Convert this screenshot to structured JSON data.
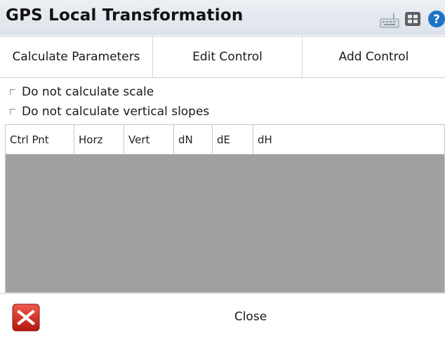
{
  "window": {
    "title": "GPS Local Transformation"
  },
  "titlebar_icons": [
    "keyboard-icon",
    "windows-icon",
    "help-icon"
  ],
  "toolbar": {
    "calculate_label": "Calculate Parameters",
    "edit_label": "Edit Control",
    "add_label": "Add Control"
  },
  "options": [
    {
      "label": "Do not calculate scale",
      "checked": false
    },
    {
      "label": "Do not calculate vertical slopes",
      "checked": false
    }
  ],
  "table": {
    "columns": [
      "Ctrl Pnt",
      "Horz",
      "Vert",
      "dN",
      "dE",
      "dH"
    ],
    "rows": []
  },
  "footer": {
    "close_label": "Close"
  },
  "colors": {
    "titlebar": "#dde2ea",
    "table_body": "#a0a0a0",
    "close_icon": "#d9261c",
    "help_icon": "#1e73c8"
  }
}
